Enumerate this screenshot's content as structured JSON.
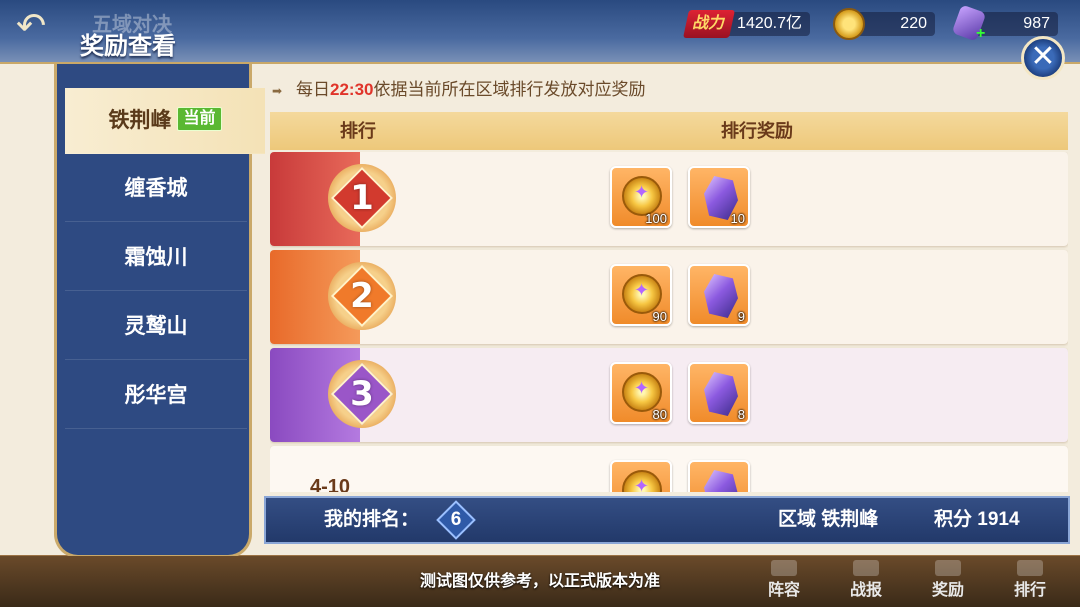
{
  "header": {
    "prev_title": "五域对决",
    "title": "奖励查看",
    "power_label": "战力",
    "power_value": "1420.7亿",
    "gold_value": "220",
    "gem_value": "987",
    "gem_plus": "+",
    "back_glyph": "↶",
    "close_glyph": "✕"
  },
  "sidebar": {
    "items": [
      {
        "label": "铁荆峰",
        "badge": "当前",
        "active": true
      },
      {
        "label": "缠香城"
      },
      {
        "label": "霜蚀川"
      },
      {
        "label": "灵鹫山"
      },
      {
        "label": "彤华宫"
      }
    ]
  },
  "notice": {
    "arrow": "➡",
    "prefix": "每日",
    "time": "22:30",
    "suffix": "依据当前所在区域排行发放对应奖励"
  },
  "table": {
    "col_rank": "排行",
    "col_reward": "排行奖励",
    "rows": [
      {
        "rank": "1",
        "coin_qty": "100",
        "gem_qty": "10"
      },
      {
        "rank": "2",
        "coin_qty": "90",
        "gem_qty": "9"
      },
      {
        "rank": "3",
        "coin_qty": "80",
        "gem_qty": "8"
      },
      {
        "rank": "4-10",
        "coin_qty": "",
        "gem_qty": ""
      }
    ]
  },
  "my_rank": {
    "label": "我的排名：",
    "value": "6",
    "region_label": "区域 铁荆峰",
    "score_label": "积分 1914"
  },
  "bottom": {
    "disclaimer": "测试图仅供参考，以正式版本为准",
    "nav": [
      {
        "label": "阵容"
      },
      {
        "label": "战报"
      },
      {
        "label": "奖励"
      },
      {
        "label": "排行"
      }
    ]
  },
  "colors": {
    "rank1": "#d8453e",
    "rank2": "#f07a2a",
    "rank3": "#9a56c8",
    "highlight": "#e0342a"
  }
}
